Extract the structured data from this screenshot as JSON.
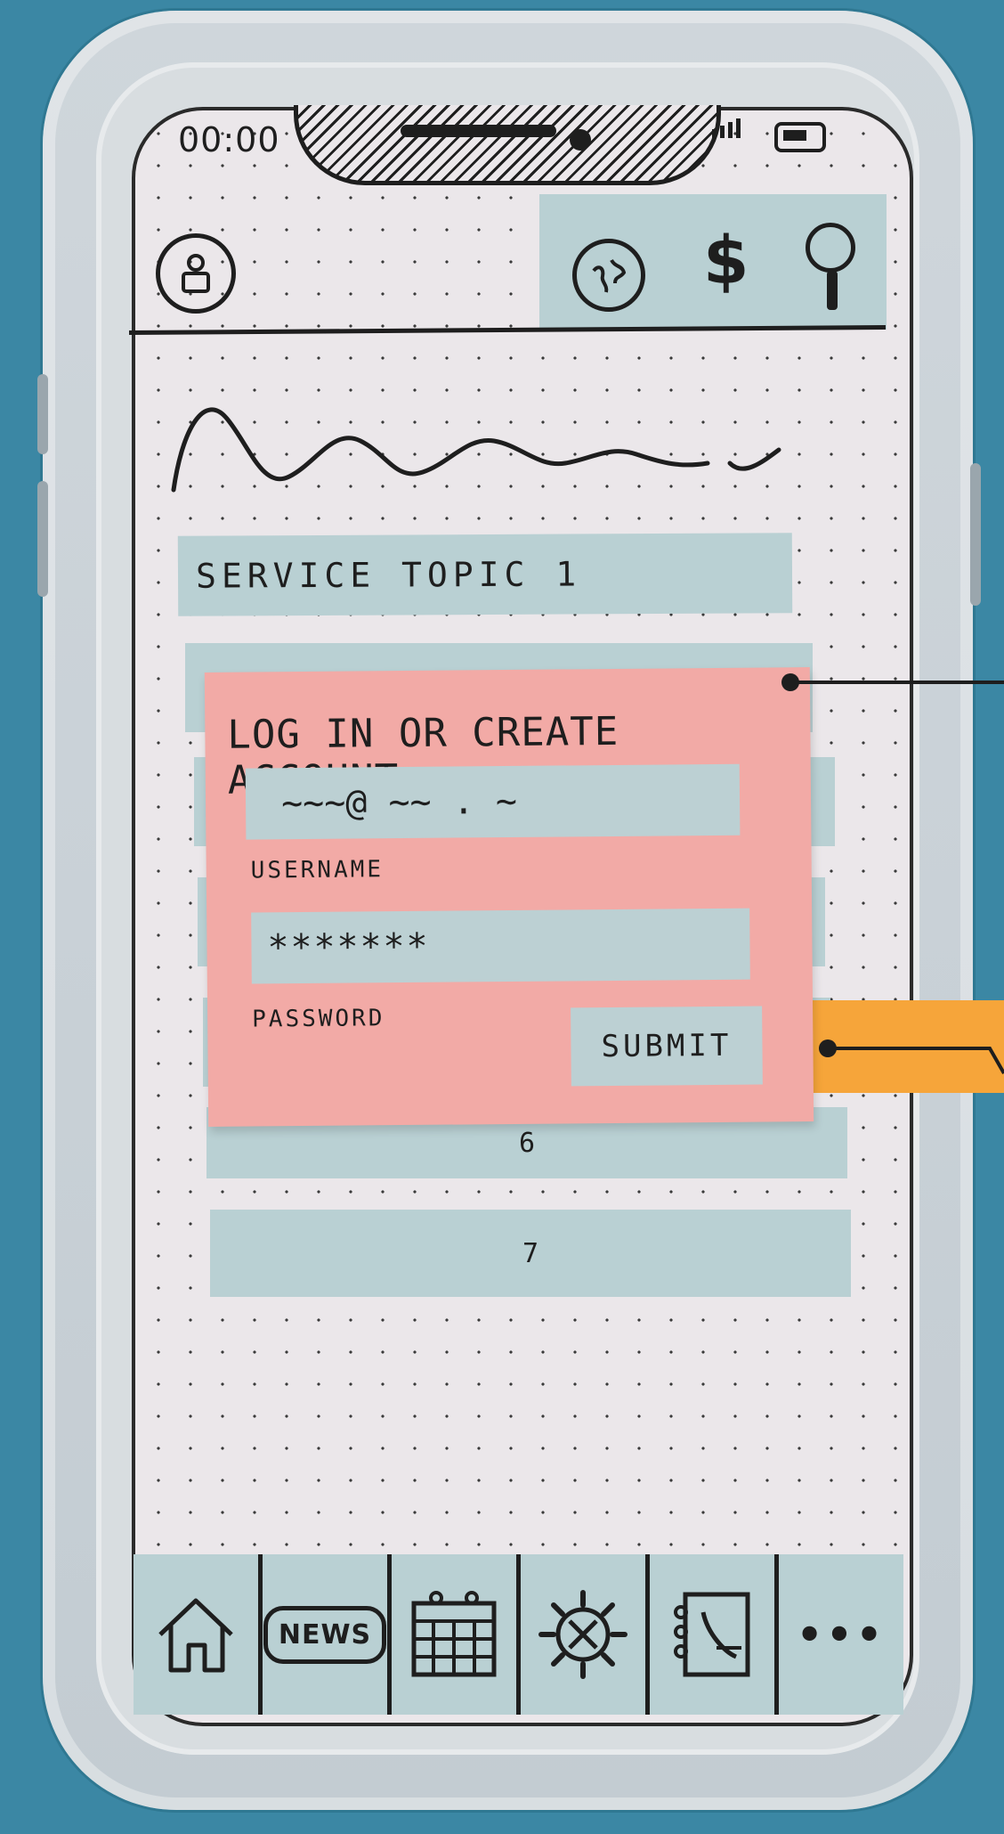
{
  "status_bar": {
    "time": "00:00"
  },
  "header": {
    "icons": [
      "profile-icon",
      "globe-icon",
      "dollar-icon",
      "search-icon"
    ],
    "dollar_glyph": "$"
  },
  "content": {
    "rows": [
      {
        "label": "SERVICE TOPIC 1"
      },
      {
        "label": ""
      },
      {
        "label": ""
      },
      {
        "label": ""
      },
      {
        "label": ""
      },
      {
        "label": "6"
      },
      {
        "label": "7"
      }
    ]
  },
  "login_card": {
    "title": "LOG IN OR CREATE ACCOUNT",
    "email_value": "~~~@ ~~ . ~",
    "username_label": "USERNAME",
    "password_value": "*******",
    "password_label": "PASSWORD",
    "submit_label": "SUBMIT"
  },
  "bottom_nav": {
    "items": [
      {
        "icon": "home-icon"
      },
      {
        "icon": "news-icon",
        "label": "NEWS"
      },
      {
        "icon": "calendar-icon"
      },
      {
        "icon": "settings-icon"
      },
      {
        "icon": "contacts-icon"
      },
      {
        "icon": "more-icon",
        "label": "•••"
      }
    ]
  },
  "colors": {
    "background": "#3b87a4",
    "paper": "#ebe7ea",
    "strip": "#b9d0d3",
    "sticky_pink": "#f2aaa6",
    "sticky_orange": "#f6a53a",
    "ink": "#1e1e1e"
  }
}
